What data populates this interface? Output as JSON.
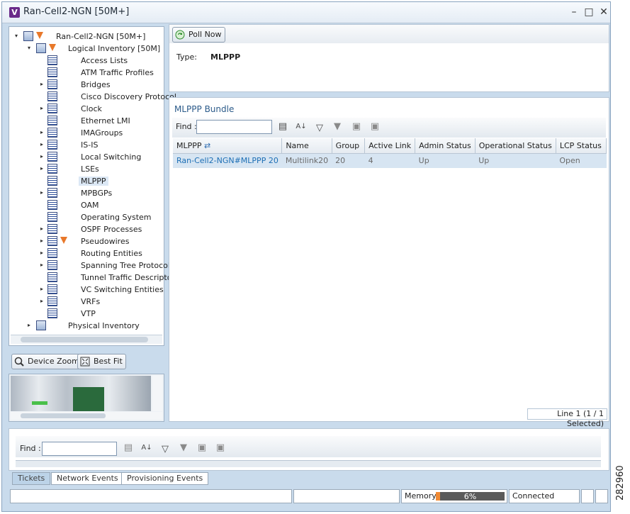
{
  "window": {
    "title": "Ran-Cell2-NGN [50M+]",
    "app_icon_letter": "V"
  },
  "tree": {
    "root": "Ran-Cell2-NGN [50M+]",
    "logical_inventory": "Logical Inventory [50M]",
    "items": [
      {
        "label": "Access Lists",
        "expander": ""
      },
      {
        "label": "ATM Traffic Profiles",
        "expander": ""
      },
      {
        "label": "Bridges",
        "expander": "▸"
      },
      {
        "label": "Cisco Discovery Protocol",
        "expander": ""
      },
      {
        "label": "Clock",
        "expander": "▸"
      },
      {
        "label": "Ethernet LMI",
        "expander": ""
      },
      {
        "label": "IMAGroups",
        "expander": "▸"
      },
      {
        "label": "IS-IS",
        "expander": "▸"
      },
      {
        "label": "Local Switching",
        "expander": "▸"
      },
      {
        "label": "LSEs",
        "expander": "▸"
      },
      {
        "label": "MLPPP",
        "expander": ""
      },
      {
        "label": "MPBGPs",
        "expander": "▸"
      },
      {
        "label": "OAM",
        "expander": ""
      },
      {
        "label": "Operating System",
        "expander": ""
      },
      {
        "label": "OSPF Processes",
        "expander": "▸"
      },
      {
        "label": "Pseudowires",
        "expander": "▸"
      },
      {
        "label": "Routing Entities",
        "expander": "▸"
      },
      {
        "label": "Spanning Tree Protocol",
        "expander": "▸"
      },
      {
        "label": "Tunnel Traffic Descriptors",
        "expander": ""
      },
      {
        "label": "VC Switching Entities",
        "expander": "▸"
      },
      {
        "label": "VRFs",
        "expander": "▸"
      },
      {
        "label": "VTP",
        "expander": ""
      }
    ],
    "physical_inventory": "Physical Inventory"
  },
  "zoom": {
    "device_zoom": "Device Zoom",
    "best_fit": "Best Fit"
  },
  "details": {
    "poll_now": "Poll Now",
    "type_label": "Type:",
    "type_value": "MLPPP"
  },
  "bundle": {
    "title": "MLPPP Bundle",
    "find_label": "Find :",
    "find_value": "",
    "columns": [
      "MLPPP",
      "Name",
      "Group",
      "Active Link",
      "Admin Status",
      "Operational Status",
      "LCP Status"
    ],
    "rows": [
      {
        "mlppp": "Ran-Cell2-NGN#MLPPP 20",
        "name": "Multilink20",
        "group": "20",
        "active_link": "4",
        "admin": "Up",
        "oper": "Up",
        "lcp": "Open"
      }
    ],
    "footer": "Line 1 (1 / 1 Selected)"
  },
  "bottom": {
    "find_label": "Find :",
    "tabs": [
      "Tickets",
      "Network Events",
      "Provisioning Events"
    ]
  },
  "status": {
    "memory_label": "Memory:",
    "memory_pct": "6%",
    "memory_fraction": 0.06,
    "connection": "Connected"
  },
  "side_number": "282960"
}
